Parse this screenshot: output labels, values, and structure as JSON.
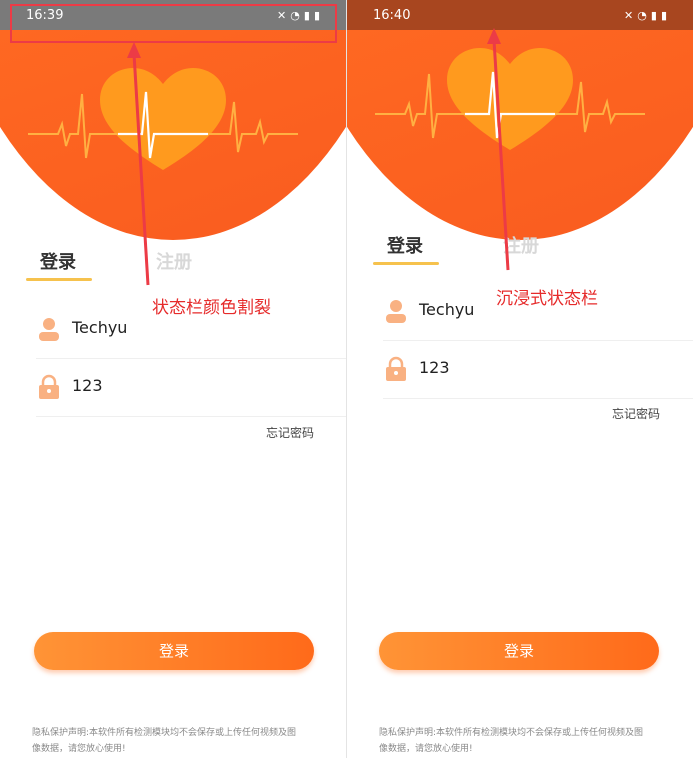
{
  "left_phone": {
    "status_time": "16:39",
    "tabs": {
      "login": "登录",
      "register": "注册"
    },
    "username": "Techyu",
    "password": "123",
    "forgot_password": "忘记密码",
    "login_button": "登录",
    "privacy_line1": "隐私保护声明:本软件所有检测模块均不会保存或上传任何视频及图",
    "privacy_line2": "像数据，请您放心使用!"
  },
  "right_phone": {
    "status_time": "16:40",
    "tabs": {
      "login": "登录",
      "register": "注册"
    },
    "username": "Techyu",
    "password": "123",
    "forgot_password": "忘记密码",
    "login_button": "登录",
    "privacy_line1": "隐私保护声明:本软件所有检测模块均不会保存或上传任何视频及图",
    "privacy_line2": "像数据，请您放心使用!"
  },
  "annotations": {
    "left_label": "状态栏颜色割裂",
    "right_label": "沉浸式状态栏"
  },
  "colors": {
    "brand_orange": "#ff6a22",
    "annotation_red": "#e62a2a",
    "tab_underline": "#f6c24d"
  }
}
